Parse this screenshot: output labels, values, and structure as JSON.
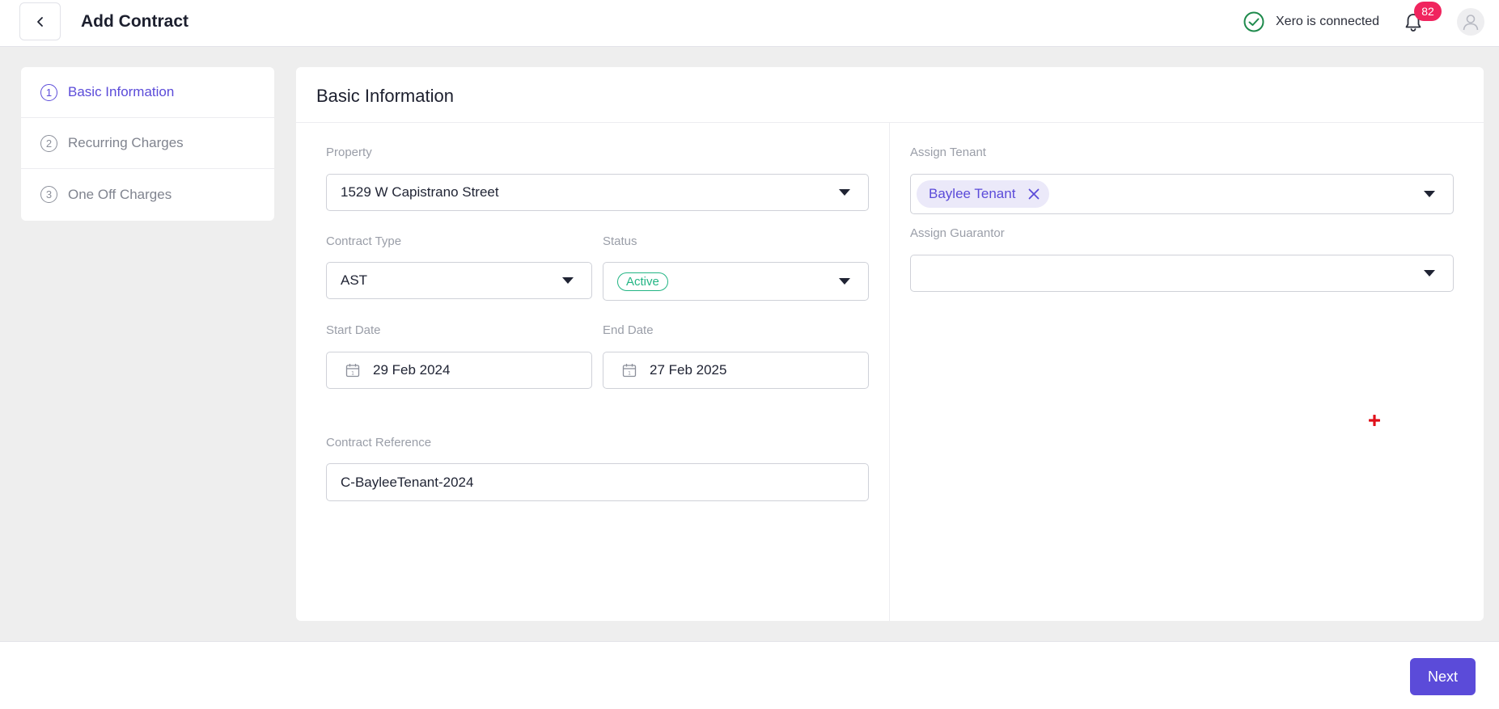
{
  "header": {
    "title": "Add Contract",
    "xero_status": "Xero is connected",
    "notification_count": "82",
    "icons": {
      "back": "chevron-left-icon",
      "xero": "check-circle-icon",
      "notifications": "bell-icon",
      "avatar": "user-icon"
    }
  },
  "steps": [
    {
      "number": "1",
      "label": "Basic Information",
      "active": true
    },
    {
      "number": "2",
      "label": "Recurring Charges",
      "active": false
    },
    {
      "number": "3",
      "label": "One Off Charges",
      "active": false
    }
  ],
  "form": {
    "title": "Basic Information",
    "property": {
      "label": "Property",
      "value": "1529 W Capistrano Street"
    },
    "contract_type": {
      "label": "Contract Type",
      "value": "AST"
    },
    "status": {
      "label": "Status",
      "value": "Active",
      "color": "#23b584"
    },
    "start_date": {
      "label": "Start Date",
      "value": "29 Feb 2024"
    },
    "end_date": {
      "label": "End Date",
      "value": "27 Feb 2025"
    },
    "contract_reference": {
      "label": "Contract Reference",
      "value": "C-BayleeTenant-2024"
    },
    "assign_tenant": {
      "label": "Assign Tenant",
      "chips": [
        "Baylee Tenant"
      ]
    },
    "assign_guarantor": {
      "label": "Assign Guarantor",
      "value": ""
    }
  },
  "footer": {
    "next_label": "Next"
  },
  "colors": {
    "accent": "#5b4bd9",
    "badge": "#f0245e",
    "success": "#23b584",
    "xero_check": "#1e8a4c"
  }
}
